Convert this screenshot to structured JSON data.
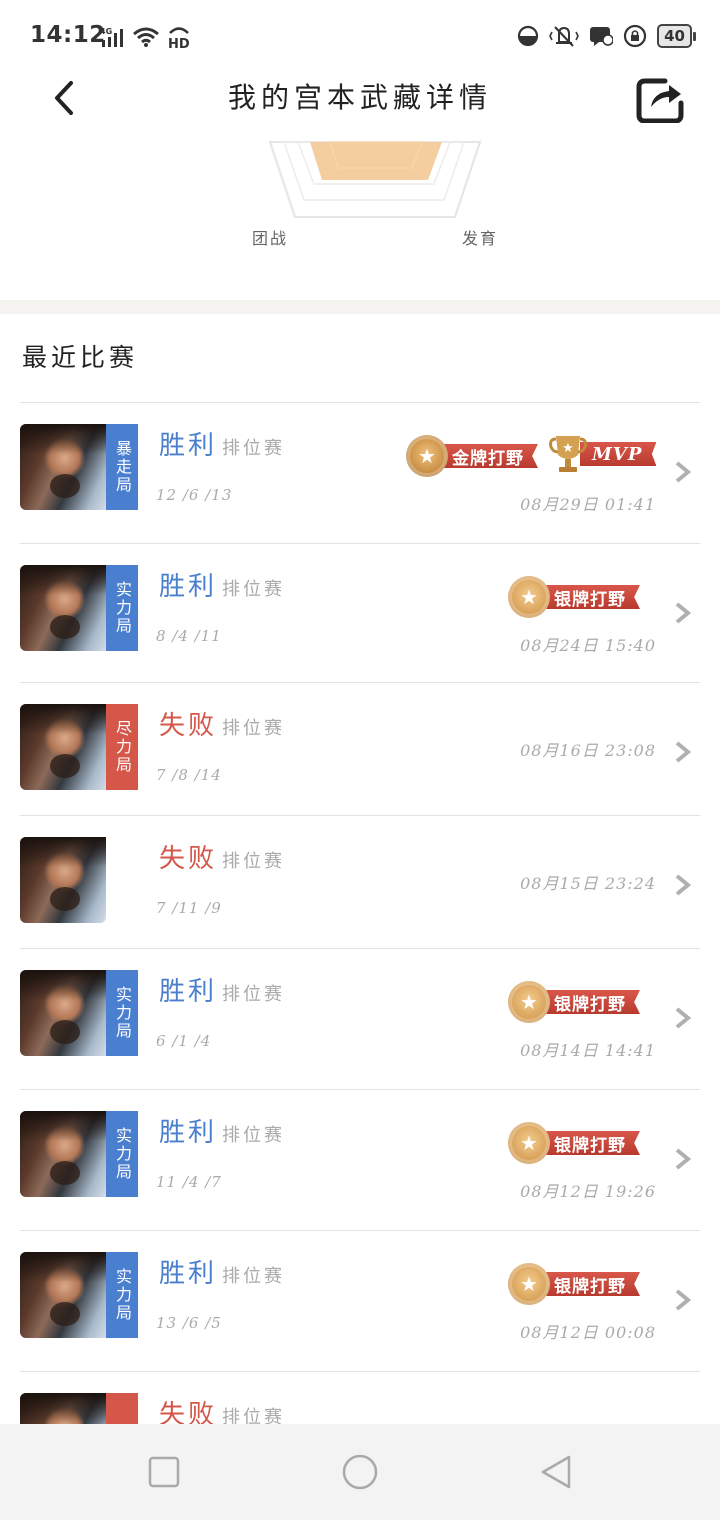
{
  "status_bar": {
    "time": "14:12",
    "network": "4G",
    "hd": "HD",
    "battery": "40"
  },
  "header": {
    "title": "我的宫本武藏详情",
    "back_icon": "chevron-left-icon",
    "share_icon": "share-icon"
  },
  "radar": {
    "labels": [
      "团战",
      "发育"
    ],
    "fill_color": "#f3c995"
  },
  "section": {
    "title": "最近比赛"
  },
  "colors": {
    "win": "#4a7fd0",
    "lose": "#d4574a",
    "muted": "#aaaaaa"
  },
  "matches": [
    {
      "result": "胜利",
      "result_type": "win",
      "mode": "排位赛",
      "tag": "暴走局",
      "tag_color": "blue",
      "kda": "12 /6 /13",
      "time": "08月29日 01:41",
      "badges": [
        {
          "type": "gold",
          "label": "金牌打野"
        },
        {
          "type": "mvp",
          "label": "MVP"
        }
      ]
    },
    {
      "result": "胜利",
      "result_type": "win",
      "mode": "排位赛",
      "tag": "实力局",
      "tag_color": "blue",
      "kda": "8 /4 /11",
      "time": "08月24日 15:40",
      "badges": [
        {
          "type": "silver",
          "label": "银牌打野"
        }
      ]
    },
    {
      "result": "失败",
      "result_type": "lose",
      "mode": "排位赛",
      "tag": "尽力局",
      "tag_color": "red",
      "kda": "7 /8 /14",
      "time": "08月16日 23:08",
      "badges": []
    },
    {
      "result": "失败",
      "result_type": "lose",
      "mode": "排位赛",
      "tag": "",
      "tag_color": "",
      "kda": "7 /11 /9",
      "time": "08月15日 23:24",
      "badges": []
    },
    {
      "result": "胜利",
      "result_type": "win",
      "mode": "排位赛",
      "tag": "实力局",
      "tag_color": "blue",
      "kda": "6 /1 /4",
      "time": "08月14日 14:41",
      "badges": [
        {
          "type": "silver",
          "label": "银牌打野"
        }
      ]
    },
    {
      "result": "胜利",
      "result_type": "win",
      "mode": "排位赛",
      "tag": "实力局",
      "tag_color": "blue",
      "kda": "11 /4 /7",
      "time": "08月12日 19:26",
      "badges": [
        {
          "type": "silver",
          "label": "银牌打野"
        }
      ]
    },
    {
      "result": "胜利",
      "result_type": "win",
      "mode": "排位赛",
      "tag": "实力局",
      "tag_color": "blue",
      "kda": "13 /6 /5",
      "time": "08月12日 00:08",
      "badges": [
        {
          "type": "silver",
          "label": "银牌打野"
        }
      ]
    },
    {
      "result": "失败",
      "result_type": "lose",
      "mode": "排位赛",
      "tag": "",
      "tag_color": "red",
      "kda": "",
      "time": "",
      "badges": []
    }
  ],
  "nav": {
    "recent_icon": "square-icon",
    "home_icon": "circle-icon",
    "back_icon": "triangle-back-icon"
  }
}
